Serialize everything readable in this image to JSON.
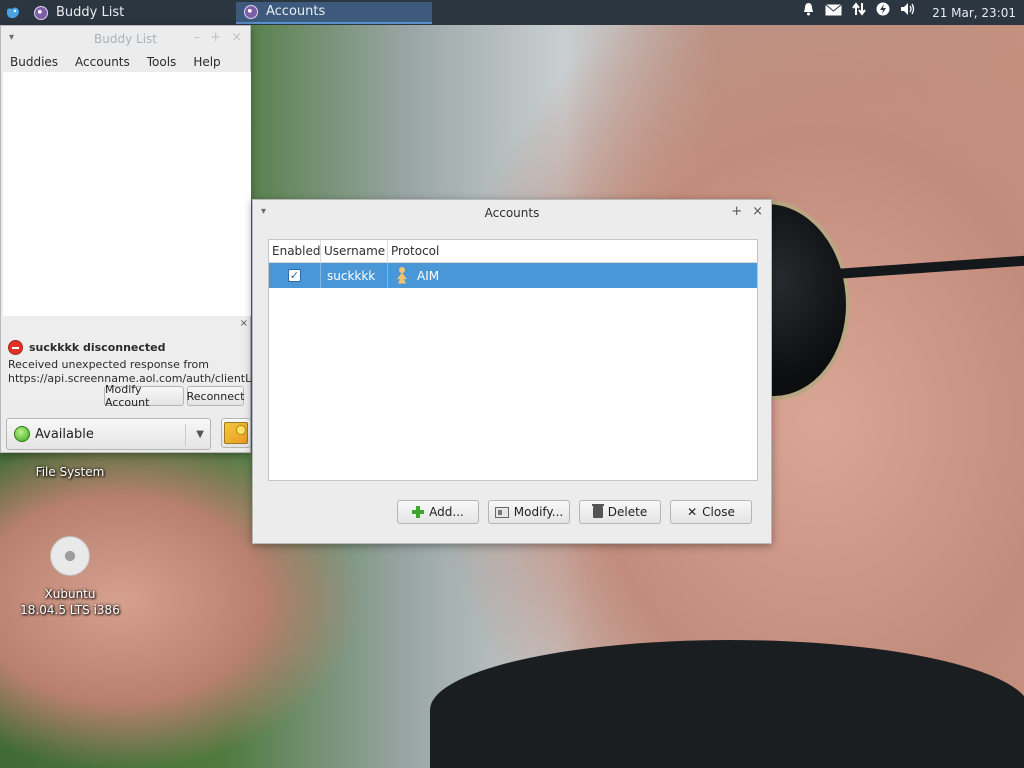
{
  "panel": {
    "tasks": [
      {
        "label": "Buddy List"
      },
      {
        "label": "Accounts"
      }
    ],
    "clock": "21 Mar, 23:01"
  },
  "desktop": {
    "file_system": "File System",
    "xubuntu_line1": "Xubuntu",
    "xubuntu_line2": "18.04.5 LTS i386"
  },
  "buddy_window": {
    "title": "Buddy List",
    "menu": [
      "Buddies",
      "Accounts",
      "Tools",
      "Help"
    ],
    "notice": {
      "title": "suckkkk disconnected",
      "message": "Received unexpected response from https://api.screenname.aol.com/auth/clientLogin",
      "modify_label": "Modify Account",
      "reconnect_label": "Reconnect"
    },
    "status": "Available"
  },
  "accounts_window": {
    "title": "Accounts",
    "columns": [
      "Enabled",
      "Username",
      "Protocol"
    ],
    "rows": [
      {
        "enabled": true,
        "username": "suckkkk",
        "protocol": "AIM"
      }
    ],
    "buttons": {
      "add": "Add...",
      "modify": "Modify...",
      "delete": "Delete",
      "close": "Close"
    }
  },
  "colors": {
    "panel_bg": "#2b3641",
    "selection": "#4a97d8",
    "error": "#e0312d",
    "available": "#3fa51b"
  },
  "icons": [
    "xfce-menu-icon",
    "pidgin-icon",
    "bell-icon",
    "mail-icon",
    "network-icon",
    "power-icon",
    "volume-icon",
    "error-icon",
    "aim-icon",
    "add-icon",
    "modify-icon",
    "trash-icon",
    "close-icon",
    "drive-icon"
  ]
}
